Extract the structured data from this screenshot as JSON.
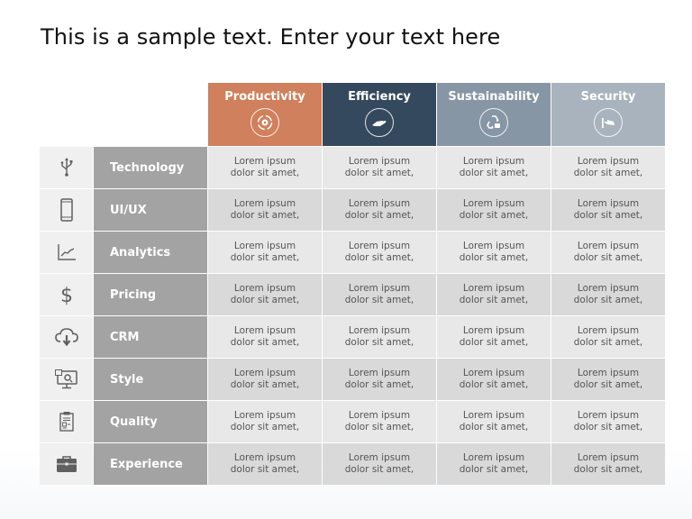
{
  "title": "This is a sample text. Enter your text here",
  "columns": [
    {
      "label": "Productivity",
      "icon": "cycle-gear-icon",
      "color": "#d0805c"
    },
    {
      "label": "Efficiency",
      "icon": "hand-icon",
      "color": "#35495e"
    },
    {
      "label": "Sustainability",
      "icon": "recycle-icon",
      "color": "#8796a5"
    },
    {
      "label": "Security",
      "icon": "cctv-camera-icon",
      "color": "#a9b3bd"
    }
  ],
  "rows": [
    {
      "label": "Technology",
      "icon": "usb-icon",
      "cells": [
        "Lorem ipsum\ndolor sit amet,",
        "Lorem ipsum\ndolor sit amet,",
        "Lorem ipsum\ndolor sit amet,",
        "Lorem ipsum\ndolor sit amet,"
      ]
    },
    {
      "label": "UI/UX",
      "icon": "smartphone-icon",
      "cells": [
        "Lorem ipsum\ndolor sit amet,",
        "Lorem ipsum\ndolor sit amet,",
        "Lorem ipsum\ndolor sit amet,",
        "Lorem ipsum\ndolor sit amet,"
      ]
    },
    {
      "label": "Analytics",
      "icon": "line-chart-icon",
      "cells": [
        "Lorem ipsum\ndolor sit amet,",
        "Lorem ipsum\ndolor sit amet,",
        "Lorem ipsum\ndolor sit amet,",
        "Lorem ipsum\ndolor sit amet,"
      ]
    },
    {
      "label": "Pricing",
      "icon": "dollar-icon",
      "cells": [
        "Lorem ipsum\ndolor sit amet,",
        "Lorem ipsum\ndolor sit amet,",
        "Lorem ipsum\ndolor sit amet,",
        "Lorem ipsum\ndolor sit amet,"
      ]
    },
    {
      "label": "CRM",
      "icon": "cloud-download-icon",
      "cells": [
        "Lorem ipsum\ndolor sit amet,",
        "Lorem ipsum\ndolor sit amet,",
        "Lorem ipsum\ndolor sit amet,",
        "Lorem ipsum\ndolor sit amet,"
      ]
    },
    {
      "label": "Style",
      "icon": "monitor-design-icon",
      "cells": [
        "Lorem ipsum\ndolor sit amet,",
        "Lorem ipsum\ndolor sit amet,",
        "Lorem ipsum\ndolor sit amet,",
        "Lorem ipsum\ndolor sit amet,"
      ]
    },
    {
      "label": "Quality",
      "icon": "clipboard-icon",
      "cells": [
        "Lorem ipsum\ndolor sit amet,",
        "Lorem ipsum\ndolor sit amet,",
        "Lorem ipsum\ndolor sit amet,",
        "Lorem ipsum\ndolor sit amet,"
      ]
    },
    {
      "label": "Experience",
      "icon": "briefcase-icon",
      "cells": [
        "Lorem ipsum\ndolor sit amet,",
        "Lorem ipsum\ndolor sit amet,",
        "Lorem ipsum\ndolor sit amet,",
        "Lorem ipsum\ndolor sit amet,"
      ]
    }
  ]
}
